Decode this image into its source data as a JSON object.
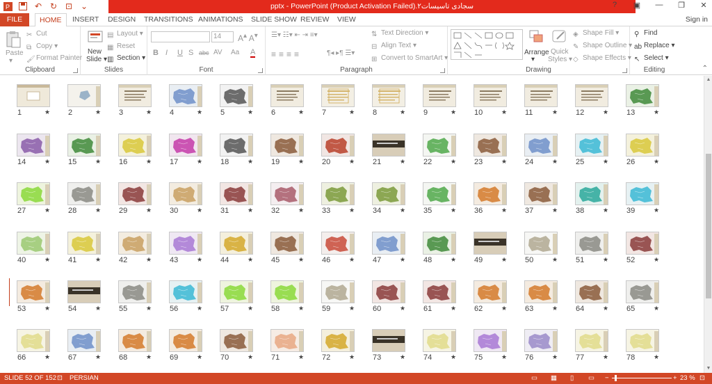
{
  "window": {
    "title": "سجادی تاسیسات۲.pptx - PowerPoint (Product Activation Failed)",
    "controls": [
      "?",
      "restore-ribbon",
      "minimize",
      "maximize",
      "close"
    ]
  },
  "quick_access": [
    "save-icon",
    "undo-icon",
    "redo-icon",
    "customize-icon"
  ],
  "tabs": [
    {
      "label": "FILE"
    },
    {
      "label": "HOME"
    },
    {
      "label": "INSERT"
    },
    {
      "label": "DESIGN"
    },
    {
      "label": "TRANSITIONS"
    },
    {
      "label": "ANIMATIONS"
    },
    {
      "label": "SLIDE SHOW"
    },
    {
      "label": "REVIEW"
    },
    {
      "label": "VIEW"
    }
  ],
  "signin": "Sign in",
  "ribbon": {
    "clipboard": {
      "label": "Clipboard",
      "paste": "Paste",
      "cut": "Cut",
      "copy": "Copy",
      "format_painter": "Format Painter"
    },
    "slides": {
      "label": "Slides",
      "new_slide": "New",
      "new_slide2": "Slide",
      "layout": "Layout",
      "reset": "Reset",
      "section": "Section"
    },
    "font": {
      "label": "Font",
      "size": "14",
      "buttons": [
        "B",
        "I",
        "U",
        "S",
        "abc",
        "AV",
        "Aa",
        "A"
      ]
    },
    "paragraph": {
      "label": "Paragraph",
      "text_direction": "Text Direction",
      "align_text": "Align Text",
      "convert_smartart": "Convert to SmartArt"
    },
    "drawing": {
      "label": "Drawing",
      "arrange": "Arrange",
      "quick_styles": "Quick",
      "quick_styles2": "Styles",
      "shape_fill": "Shape Fill",
      "shape_outline": "Shape Outline",
      "shape_effects": "Shape Effects"
    },
    "editing": {
      "label": "Editing",
      "find": "Find",
      "replace": "Replace",
      "select": "Select"
    }
  },
  "slides": [
    {
      "n": "1",
      "style": "title"
    },
    {
      "n": "2",
      "style": "blank"
    },
    {
      "n": "3",
      "style": "text"
    },
    {
      "n": "4",
      "style": "map-blue"
    },
    {
      "n": "5",
      "style": "map-line"
    },
    {
      "n": "6",
      "style": "text"
    },
    {
      "n": "7",
      "style": "text-box"
    },
    {
      "n": "8",
      "style": "text-box"
    },
    {
      "n": "9",
      "style": "text"
    },
    {
      "n": "10",
      "style": "text"
    },
    {
      "n": "11",
      "style": "text"
    },
    {
      "n": "12",
      "style": "text"
    },
    {
      "n": "13",
      "style": "map-green"
    },
    {
      "n": "14",
      "style": "map-purple"
    },
    {
      "n": "15",
      "style": "map-green"
    },
    {
      "n": "16",
      "style": "map-yellow"
    },
    {
      "n": "17",
      "style": "map-magenta"
    },
    {
      "n": "18",
      "style": "map-line"
    },
    {
      "n": "19",
      "style": "map-brown"
    },
    {
      "n": "20",
      "style": "map-red"
    },
    {
      "n": "21",
      "style": "dark-band"
    },
    {
      "n": "22",
      "style": "map-small-green"
    },
    {
      "n": "23",
      "style": "map-brown"
    },
    {
      "n": "24",
      "style": "map-blue"
    },
    {
      "n": "25",
      "style": "map-cyan"
    },
    {
      "n": "26",
      "style": "map-yellow"
    },
    {
      "n": "27",
      "style": "map-lime"
    },
    {
      "n": "28",
      "style": "map-gray"
    },
    {
      "n": "29",
      "style": "map-maroon"
    },
    {
      "n": "30",
      "style": "map-tan"
    },
    {
      "n": "31",
      "style": "map-maroon"
    },
    {
      "n": "32",
      "style": "map-pinkline"
    },
    {
      "n": "33",
      "style": "map-olive"
    },
    {
      "n": "34",
      "style": "map-olive"
    },
    {
      "n": "35",
      "style": "map-small-green"
    },
    {
      "n": "36",
      "style": "map-orange"
    },
    {
      "n": "37",
      "style": "map-brown"
    },
    {
      "n": "38",
      "style": "map-teal"
    },
    {
      "n": "39",
      "style": "map-cyan"
    },
    {
      "n": "40",
      "style": "map-lightgreen"
    },
    {
      "n": "41",
      "style": "map-yellow"
    },
    {
      "n": "42",
      "style": "map-tan"
    },
    {
      "n": "43",
      "style": "map-violet"
    },
    {
      "n": "44",
      "style": "map-gold"
    },
    {
      "n": "45",
      "style": "map-brown"
    },
    {
      "n": "46",
      "style": "map-red-small"
    },
    {
      "n": "47",
      "style": "map-blue"
    },
    {
      "n": "48",
      "style": "map-green"
    },
    {
      "n": "49",
      "style": "dark-band"
    },
    {
      "n": "50",
      "style": "map-white"
    },
    {
      "n": "51",
      "style": "map-gray"
    },
    {
      "n": "52",
      "style": "map-maroon"
    },
    {
      "n": "53",
      "style": "map-orange"
    },
    {
      "n": "54",
      "style": "dark-band"
    },
    {
      "n": "55",
      "style": "map-gray"
    },
    {
      "n": "56",
      "style": "map-cyan"
    },
    {
      "n": "57",
      "style": "map-lime"
    },
    {
      "n": "58",
      "style": "map-lime"
    },
    {
      "n": "59",
      "style": "map-white"
    },
    {
      "n": "60",
      "style": "map-maroon"
    },
    {
      "n": "61",
      "style": "map-maroon"
    },
    {
      "n": "62",
      "style": "map-orange"
    },
    {
      "n": "63",
      "style": "map-orange"
    },
    {
      "n": "64",
      "style": "map-brown"
    },
    {
      "n": "65",
      "style": "map-gray"
    },
    {
      "n": "66",
      "style": "map-paleyellow"
    },
    {
      "n": "67",
      "style": "map-blue"
    },
    {
      "n": "68",
      "style": "map-orange"
    },
    {
      "n": "69",
      "style": "map-orange"
    },
    {
      "n": "70",
      "style": "map-brown"
    },
    {
      "n": "71",
      "style": "map-peach"
    },
    {
      "n": "72",
      "style": "map-gold"
    },
    {
      "n": "73",
      "style": "dark-band"
    },
    {
      "n": "74",
      "style": "map-paleyellow"
    },
    {
      "n": "75",
      "style": "map-violet"
    },
    {
      "n": "76",
      "style": "map-lavender"
    },
    {
      "n": "77",
      "style": "map-paleyellow"
    },
    {
      "n": "78",
      "style": "map-paleyellow"
    }
  ],
  "star": "★",
  "status": {
    "slide": "SLIDE 52 OF 152",
    "language": "PERSIAN",
    "zoom": "23 %",
    "zoom_fraction": 0.05
  },
  "colors": {
    "accent": "#d24726",
    "title_red": "#e32a1c"
  }
}
